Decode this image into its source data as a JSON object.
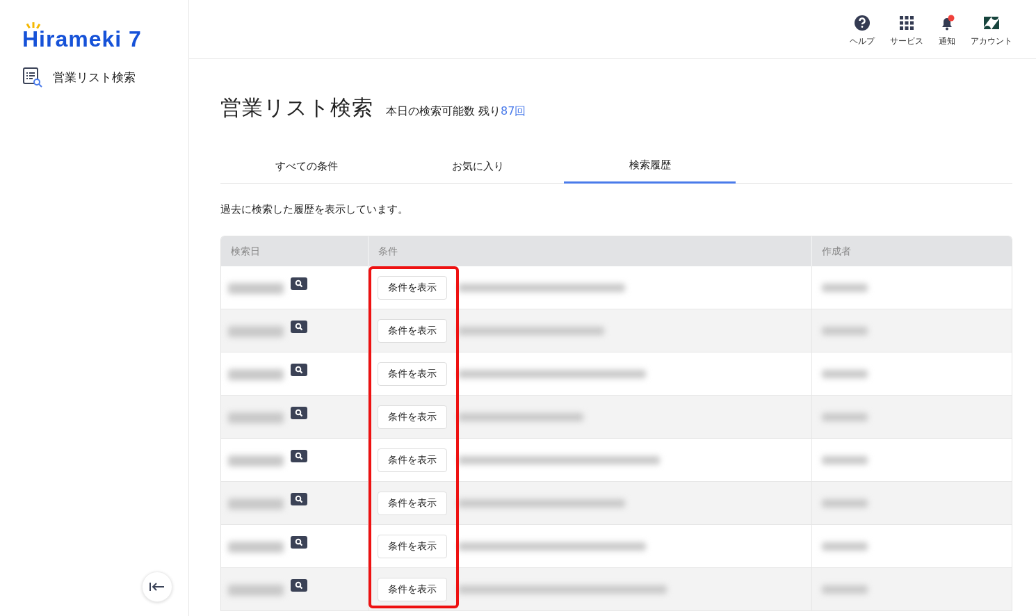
{
  "logo": {
    "text": "Hirameki 7"
  },
  "sidebar": {
    "items": [
      {
        "label": "営業リスト検索",
        "selected": false
      }
    ]
  },
  "header": {
    "nav": [
      {
        "kind": "help",
        "label": "ヘルプ"
      },
      {
        "kind": "services",
        "label": "サービス"
      },
      {
        "kind": "notifications",
        "label": "通知",
        "unread": true
      },
      {
        "kind": "account",
        "label": "アカウント"
      }
    ]
  },
  "page": {
    "title": "営業リスト検索",
    "quota_label": "本日の検索可能数 残り",
    "quota_value": "87回"
  },
  "tabs": [
    {
      "label": "すべての条件",
      "selected": false
    },
    {
      "label": "お気に入り",
      "selected": false
    },
    {
      "label": "検索履歴",
      "selected": true
    }
  ],
  "description": "過去に検索した履歴を表示しています。",
  "table": {
    "columns": [
      {
        "label": "検索日",
        "highlighted": false
      },
      {
        "label": "条件",
        "highlighted": true
      },
      {
        "label": "作成者",
        "highlighted": false
      }
    ],
    "rows": [
      {
        "button": "条件を表示"
      },
      {
        "button": "条件を表示"
      },
      {
        "button": "条件を表示"
      },
      {
        "button": "条件を表示"
      },
      {
        "button": "条件を表示"
      },
      {
        "button": "条件を表示"
      },
      {
        "button": "条件を表示"
      },
      {
        "button": "条件を表示"
      }
    ]
  }
}
